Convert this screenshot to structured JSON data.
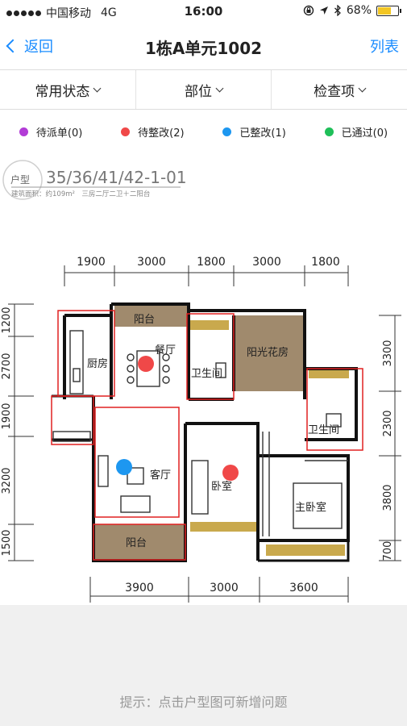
{
  "status_bar": {
    "carrier": "中国移动",
    "network": "4G",
    "time": "16:00",
    "battery": "68%",
    "battery_level": 0.68,
    "icons": [
      "signal-dots-icon",
      "lock-rotation-icon",
      "location-arrow-icon",
      "bluetooth-icon",
      "battery-icon"
    ]
  },
  "nav": {
    "back_label": "返回",
    "title": "1栋A单元1002",
    "right_label": "列表"
  },
  "filters": [
    {
      "label": "常用状态"
    },
    {
      "label": "部位"
    },
    {
      "label": "检查项"
    }
  ],
  "legend": [
    {
      "label": "待派单(0)",
      "color": "#b23cd6"
    },
    {
      "label": "待整改(2)",
      "color": "#f04848"
    },
    {
      "label": "已整改(1)",
      "color": "#1d97f0"
    },
    {
      "label": "已通过(0)",
      "color": "#1fbf59"
    }
  ],
  "floorplan": {
    "type_prefix": "户型",
    "type_code": "35/36/41/42-1-01",
    "subtitle": "建筑面积：约109m²　三房二厅二卫＋二阳台",
    "top_dims": [
      "1900",
      "3000",
      "1800",
      "3000",
      "1800"
    ],
    "bottom_dims": [
      "3900",
      "3000",
      "3600"
    ],
    "left_dims": [
      "1200",
      "2700",
      "1900",
      "3200",
      "1500"
    ],
    "right_dims": [
      "3300",
      "2300",
      "3800",
      "700"
    ],
    "rooms": {
      "balcony_top": "阳台",
      "dining": "餐厅",
      "kitchen": "厨房",
      "bath1": "卫生间",
      "sunroom": "阳光花房",
      "bath2": "卫生间",
      "living": "客厅",
      "bedroom": "卧室",
      "master": "主卧室",
      "balcony_bottom": "阳台"
    },
    "markers": [
      {
        "status": "待整改",
        "color": "#f04848"
      },
      {
        "status": "待整改",
        "color": "#f04848"
      },
      {
        "status": "已整改",
        "color": "#1d97f0"
      }
    ]
  },
  "footer": {
    "hint": "提示：点击户型图可新增问题"
  }
}
